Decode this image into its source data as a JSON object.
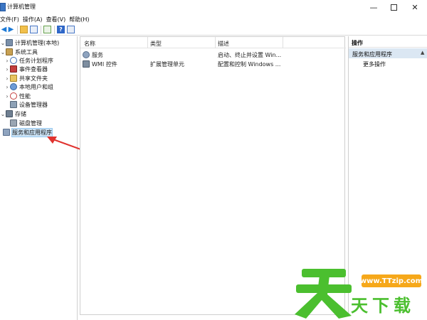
{
  "window": {
    "title": "计算机管理",
    "minimize_icon": "minimize-icon",
    "maximize_icon": "maximize-icon",
    "close_icon": "close-icon",
    "close_glyph": "✕",
    "minimize_glyph": "—"
  },
  "menu": {
    "items": [
      "文件(F)",
      "操作(A)",
      "查看(V)",
      "帮助(H)"
    ]
  },
  "toolbar": {
    "icons": [
      "back-arrow-icon",
      "forward-arrow-icon",
      "up-folder-icon",
      "show-tree-icon",
      "export-list-icon",
      "help-icon",
      "action-pane-icon"
    ],
    "help_glyph": "?"
  },
  "tree": {
    "items": [
      {
        "label": "计算机管理(本地)",
        "expanded": true,
        "icon": "computer-management-icon"
      },
      {
        "label": "系统工具",
        "expanded": true,
        "icon": "system-tools-icon"
      },
      {
        "label": "任务计划程序",
        "expanded": false,
        "icon": "task-scheduler-icon"
      },
      {
        "label": "事件查看器",
        "expanded": false,
        "icon": "event-viewer-icon"
      },
      {
        "label": "共享文件夹",
        "expanded": false,
        "icon": "shared-folders-icon"
      },
      {
        "label": "本地用户和组",
        "expanded": false,
        "icon": "local-users-icon"
      },
      {
        "label": "性能",
        "expanded": false,
        "icon": "performance-icon"
      },
      {
        "label": "设备管理器",
        "expanded": false,
        "icon": "device-manager-icon"
      },
      {
        "label": "存储",
        "expanded": true,
        "icon": "storage-icon"
      },
      {
        "label": "磁盘管理",
        "expanded": false,
        "icon": "disk-management-icon"
      },
      {
        "label": "服务和应用程序",
        "expanded": false,
        "icon": "services-apps-icon",
        "selected": true
      }
    ]
  },
  "list": {
    "columns": [
      "名称",
      "类型",
      "描述"
    ],
    "rows": [
      {
        "name": "服务",
        "type": "",
        "description": "启动、终止并设置 Win...",
        "icon": "services-icon"
      },
      {
        "name": "WMI 控件",
        "type": "扩展管理单元",
        "description": "配置和控制 Windows ...",
        "icon": "wmi-control-icon"
      }
    ]
  },
  "actions": {
    "header": "操作",
    "section_title": "服务和应用程序",
    "items": [
      "更多操作"
    ]
  },
  "annotation": {
    "color": "#e0322e"
  },
  "watermark": {
    "url": "www.TTzip.com",
    "text_chars": [
      "天",
      "下",
      "载"
    ],
    "color_green": "#4bbf2f",
    "color_orange": "#f6a81a"
  },
  "colors": {
    "selection": "#cce4f7",
    "section_bg": "#dbe7f3",
    "accent_blue": "#1d7ad6"
  }
}
